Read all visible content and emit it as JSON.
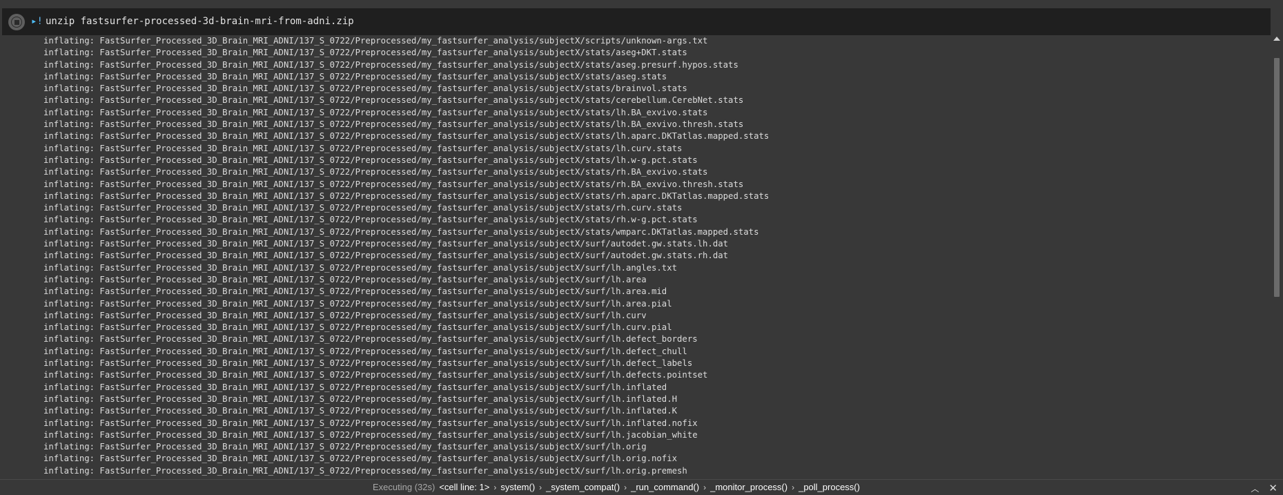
{
  "cell": {
    "command_prefix": "!",
    "command": "unzip fastsurfer-processed-3d-brain-mri-from-adni.zip"
  },
  "output": {
    "lines": [
      "inflating: FastSurfer_Processed_3D_Brain_MRI_ADNI/137_S_0722/Preprocessed/my_fastsurfer_analysis/subjectX/scripts/unknown-args.txt",
      "inflating: FastSurfer_Processed_3D_Brain_MRI_ADNI/137_S_0722/Preprocessed/my_fastsurfer_analysis/subjectX/stats/aseg+DKT.stats",
      "inflating: FastSurfer_Processed_3D_Brain_MRI_ADNI/137_S_0722/Preprocessed/my_fastsurfer_analysis/subjectX/stats/aseg.presurf.hypos.stats",
      "inflating: FastSurfer_Processed_3D_Brain_MRI_ADNI/137_S_0722/Preprocessed/my_fastsurfer_analysis/subjectX/stats/aseg.stats",
      "inflating: FastSurfer_Processed_3D_Brain_MRI_ADNI/137_S_0722/Preprocessed/my_fastsurfer_analysis/subjectX/stats/brainvol.stats",
      "inflating: FastSurfer_Processed_3D_Brain_MRI_ADNI/137_S_0722/Preprocessed/my_fastsurfer_analysis/subjectX/stats/cerebellum.CerebNet.stats",
      "inflating: FastSurfer_Processed_3D_Brain_MRI_ADNI/137_S_0722/Preprocessed/my_fastsurfer_analysis/subjectX/stats/lh.BA_exvivo.stats",
      "inflating: FastSurfer_Processed_3D_Brain_MRI_ADNI/137_S_0722/Preprocessed/my_fastsurfer_analysis/subjectX/stats/lh.BA_exvivo.thresh.stats",
      "inflating: FastSurfer_Processed_3D_Brain_MRI_ADNI/137_S_0722/Preprocessed/my_fastsurfer_analysis/subjectX/stats/lh.aparc.DKTatlas.mapped.stats",
      "inflating: FastSurfer_Processed_3D_Brain_MRI_ADNI/137_S_0722/Preprocessed/my_fastsurfer_analysis/subjectX/stats/lh.curv.stats",
      "inflating: FastSurfer_Processed_3D_Brain_MRI_ADNI/137_S_0722/Preprocessed/my_fastsurfer_analysis/subjectX/stats/lh.w-g.pct.stats",
      "inflating: FastSurfer_Processed_3D_Brain_MRI_ADNI/137_S_0722/Preprocessed/my_fastsurfer_analysis/subjectX/stats/rh.BA_exvivo.stats",
      "inflating: FastSurfer_Processed_3D_Brain_MRI_ADNI/137_S_0722/Preprocessed/my_fastsurfer_analysis/subjectX/stats/rh.BA_exvivo.thresh.stats",
      "inflating: FastSurfer_Processed_3D_Brain_MRI_ADNI/137_S_0722/Preprocessed/my_fastsurfer_analysis/subjectX/stats/rh.aparc.DKTatlas.mapped.stats",
      "inflating: FastSurfer_Processed_3D_Brain_MRI_ADNI/137_S_0722/Preprocessed/my_fastsurfer_analysis/subjectX/stats/rh.curv.stats",
      "inflating: FastSurfer_Processed_3D_Brain_MRI_ADNI/137_S_0722/Preprocessed/my_fastsurfer_analysis/subjectX/stats/rh.w-g.pct.stats",
      "inflating: FastSurfer_Processed_3D_Brain_MRI_ADNI/137_S_0722/Preprocessed/my_fastsurfer_analysis/subjectX/stats/wmparc.DKTatlas.mapped.stats",
      "inflating: FastSurfer_Processed_3D_Brain_MRI_ADNI/137_S_0722/Preprocessed/my_fastsurfer_analysis/subjectX/surf/autodet.gw.stats.lh.dat",
      "inflating: FastSurfer_Processed_3D_Brain_MRI_ADNI/137_S_0722/Preprocessed/my_fastsurfer_analysis/subjectX/surf/autodet.gw.stats.rh.dat",
      "inflating: FastSurfer_Processed_3D_Brain_MRI_ADNI/137_S_0722/Preprocessed/my_fastsurfer_analysis/subjectX/surf/lh.angles.txt",
      "inflating: FastSurfer_Processed_3D_Brain_MRI_ADNI/137_S_0722/Preprocessed/my_fastsurfer_analysis/subjectX/surf/lh.area",
      "inflating: FastSurfer_Processed_3D_Brain_MRI_ADNI/137_S_0722/Preprocessed/my_fastsurfer_analysis/subjectX/surf/lh.area.mid",
      "inflating: FastSurfer_Processed_3D_Brain_MRI_ADNI/137_S_0722/Preprocessed/my_fastsurfer_analysis/subjectX/surf/lh.area.pial",
      "inflating: FastSurfer_Processed_3D_Brain_MRI_ADNI/137_S_0722/Preprocessed/my_fastsurfer_analysis/subjectX/surf/lh.curv",
      "inflating: FastSurfer_Processed_3D_Brain_MRI_ADNI/137_S_0722/Preprocessed/my_fastsurfer_analysis/subjectX/surf/lh.curv.pial",
      "inflating: FastSurfer_Processed_3D_Brain_MRI_ADNI/137_S_0722/Preprocessed/my_fastsurfer_analysis/subjectX/surf/lh.defect_borders",
      "inflating: FastSurfer_Processed_3D_Brain_MRI_ADNI/137_S_0722/Preprocessed/my_fastsurfer_analysis/subjectX/surf/lh.defect_chull",
      "inflating: FastSurfer_Processed_3D_Brain_MRI_ADNI/137_S_0722/Preprocessed/my_fastsurfer_analysis/subjectX/surf/lh.defect_labels",
      "inflating: FastSurfer_Processed_3D_Brain_MRI_ADNI/137_S_0722/Preprocessed/my_fastsurfer_analysis/subjectX/surf/lh.defects.pointset",
      "inflating: FastSurfer_Processed_3D_Brain_MRI_ADNI/137_S_0722/Preprocessed/my_fastsurfer_analysis/subjectX/surf/lh.inflated",
      "inflating: FastSurfer_Processed_3D_Brain_MRI_ADNI/137_S_0722/Preprocessed/my_fastsurfer_analysis/subjectX/surf/lh.inflated.H",
      "inflating: FastSurfer_Processed_3D_Brain_MRI_ADNI/137_S_0722/Preprocessed/my_fastsurfer_analysis/subjectX/surf/lh.inflated.K",
      "inflating: FastSurfer_Processed_3D_Brain_MRI_ADNI/137_S_0722/Preprocessed/my_fastsurfer_analysis/subjectX/surf/lh.inflated.nofix",
      "inflating: FastSurfer_Processed_3D_Brain_MRI_ADNI/137_S_0722/Preprocessed/my_fastsurfer_analysis/subjectX/surf/lh.jacobian_white",
      "inflating: FastSurfer_Processed_3D_Brain_MRI_ADNI/137_S_0722/Preprocessed/my_fastsurfer_analysis/subjectX/surf/lh.orig",
      "inflating: FastSurfer_Processed_3D_Brain_MRI_ADNI/137_S_0722/Preprocessed/my_fastsurfer_analysis/subjectX/surf/lh.orig.nofix",
      "inflating: FastSurfer_Processed_3D_Brain_MRI_ADNI/137_S_0722/Preprocessed/my_fastsurfer_analysis/subjectX/surf/lh.orig.premesh"
    ]
  },
  "status_bar": {
    "executing": "Executing (32s)",
    "call_stack": [
      "<cell line: 1>",
      "system()",
      "_system_compat()",
      "_run_command()",
      "_monitor_process()",
      "_poll_process()"
    ]
  },
  "icons": {
    "run": "stop-execution-icon",
    "scroll_up": "scroll-up-arrow-icon",
    "collapse": "chevron-up-icon",
    "close": "close-icon"
  },
  "colors": {
    "background": "#383838",
    "cell_input": "#1f1f1f",
    "command_text": "#e3e3e3",
    "output_text": "#dcdcdc",
    "bang_accent": "#4fc1ff"
  }
}
